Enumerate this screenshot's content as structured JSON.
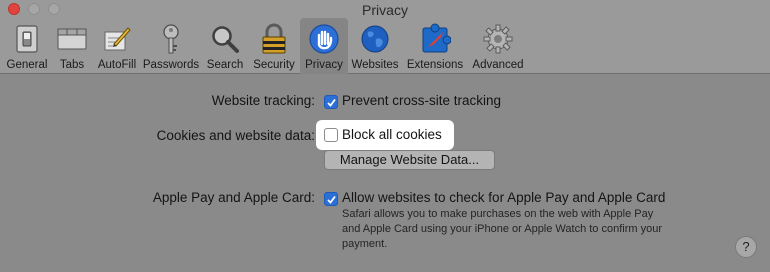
{
  "window": {
    "title": "Privacy"
  },
  "toolbar": {
    "tabs": [
      {
        "label": "General",
        "icon": "general-switch-icon"
      },
      {
        "label": "Tabs",
        "icon": "tabs-icon"
      },
      {
        "label": "AutoFill",
        "icon": "pencil-icon"
      },
      {
        "label": "Passwords",
        "icon": "key-icon"
      },
      {
        "label": "Search",
        "icon": "magnifier-icon"
      },
      {
        "label": "Security",
        "icon": "padlock-icon"
      },
      {
        "label": "Privacy",
        "icon": "hand-icon",
        "active": true
      },
      {
        "label": "Websites",
        "icon": "globe-icon"
      },
      {
        "label": "Extensions",
        "icon": "puzzle-icon"
      },
      {
        "label": "Advanced",
        "icon": "gear-icon"
      }
    ]
  },
  "settings": {
    "website_tracking": {
      "label": "Website tracking:",
      "option": "Prevent cross-site tracking",
      "checked": true
    },
    "cookies": {
      "label": "Cookies and website data:",
      "option": "Block all cookies",
      "checked": false,
      "button": "Manage Website Data..."
    },
    "apple_pay": {
      "label": "Apple Pay and Apple Card:",
      "option": "Allow websites to check for Apple Pay and Apple Card",
      "checked": true,
      "description_lines": [
        "Safari allows you to make purchases on the web with Apple Pay",
        "and Apple Card using your iPhone or Apple Watch to confirm your",
        "payment."
      ]
    }
  },
  "help": {
    "label": "?"
  },
  "colors": {
    "accent": "#2c6fd6",
    "background": "#8a8a8a",
    "close": "#e0443e"
  }
}
